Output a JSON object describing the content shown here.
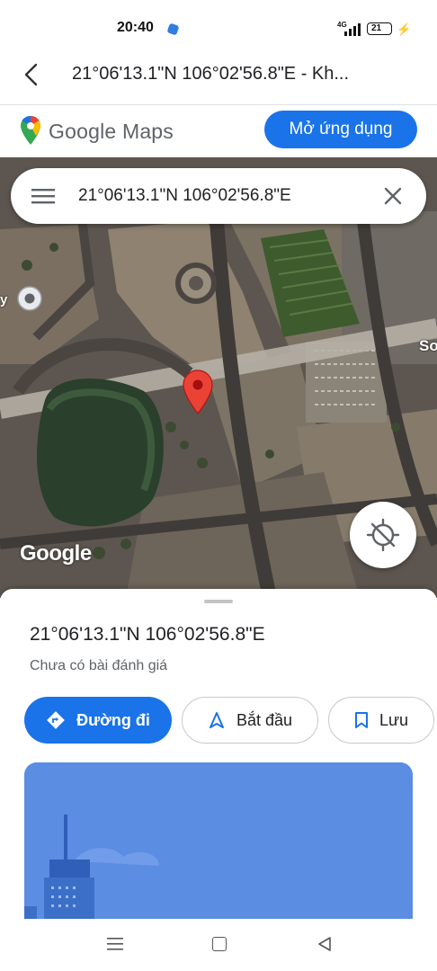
{
  "status_bar": {
    "time": "20:40",
    "network": "4G",
    "battery": "21",
    "charging_icon": "bolt-icon"
  },
  "browser": {
    "title": "21°06'13.1\"N 106°02'56.8\"E - Kh...",
    "back_icon": "chevron-left-icon"
  },
  "maps_header": {
    "logo_text": "Google Maps",
    "open_app_label": "Mở ứng dụng",
    "accent": "#1a73e8"
  },
  "search": {
    "query": "21°06'13.1\"N 106°02'56.8\"E",
    "menu_icon": "menu-icon",
    "clear_icon": "close-icon"
  },
  "map": {
    "watermark": "Google",
    "poi_label": "y",
    "edge_label": "So",
    "location_icon": "gps-off-icon",
    "pin_color": "#ea4335"
  },
  "place": {
    "title": "21°06'13.1\"N 106°02'56.8\"E",
    "subtitle": "Chưa có bài đánh giá",
    "actions": {
      "directions": "Đường đi",
      "start": "Bắt đầu",
      "save": "Lưu"
    }
  }
}
